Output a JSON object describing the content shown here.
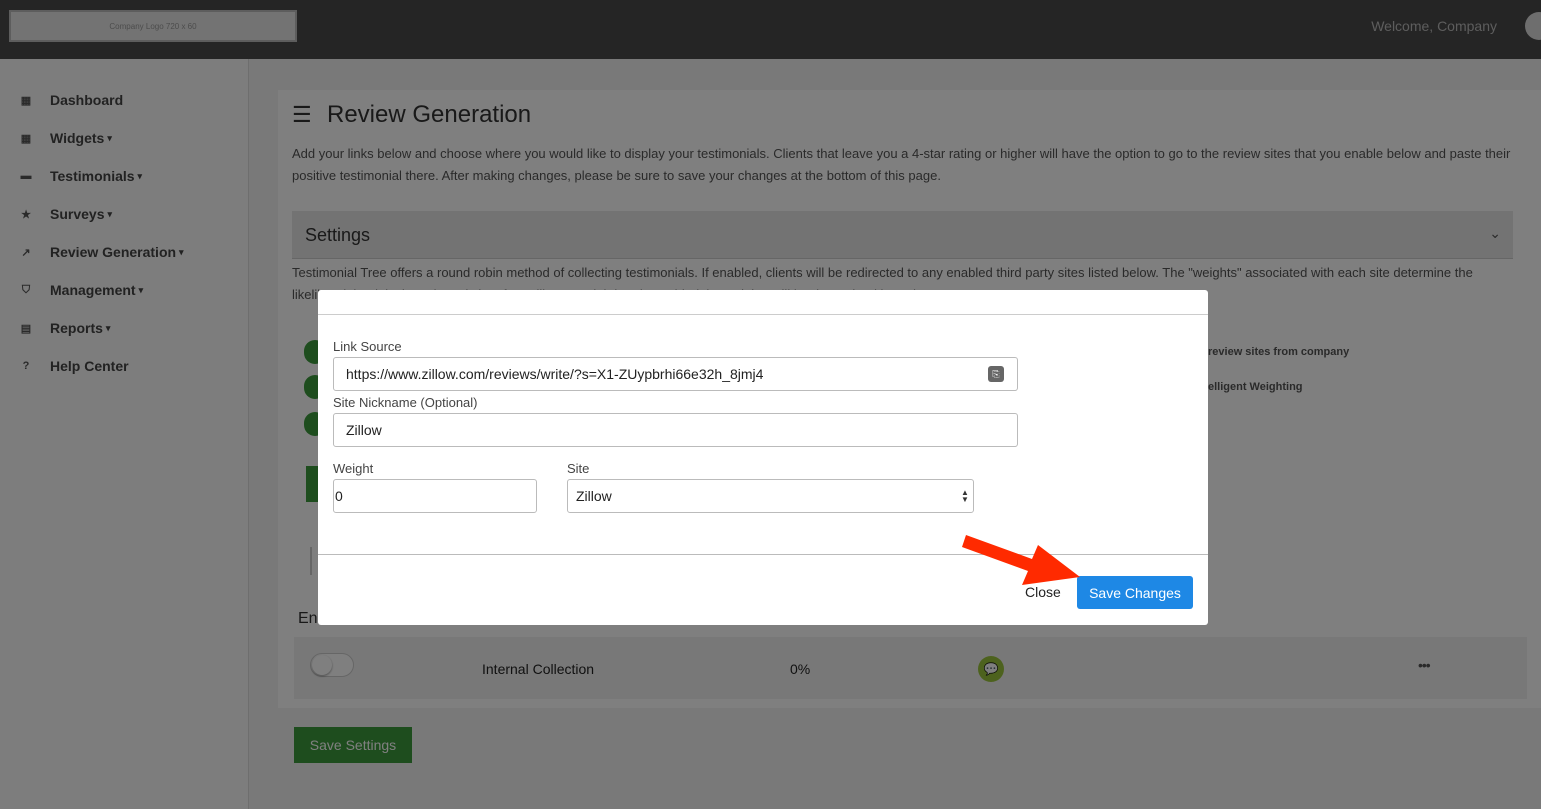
{
  "header": {
    "logo_text": "Company Logo 720 x 60",
    "welcome": "Welcome, Company"
  },
  "sidebar": {
    "items": [
      {
        "label": "Dashboard",
        "icon": "dashboard-icon",
        "has_caret": false
      },
      {
        "label": "Widgets",
        "icon": "widgets-icon",
        "has_caret": true
      },
      {
        "label": "Testimonials",
        "icon": "comment-icon",
        "has_caret": true
      },
      {
        "label": "Surveys",
        "icon": "star-icon",
        "has_caret": true
      },
      {
        "label": "Review Generation",
        "icon": "share-icon",
        "has_caret": true
      },
      {
        "label": "Management",
        "icon": "shield-icon",
        "has_caret": true
      },
      {
        "label": "Reports",
        "icon": "reports-icon",
        "has_caret": true
      },
      {
        "label": "Help Center",
        "icon": "help-icon",
        "has_caret": false
      }
    ]
  },
  "main": {
    "title": "Review Generation",
    "description": "Add your links below and choose where you would like to display your testimonials. Clients that leave you a 4-star rating or higher will have the option to go to the review sites that you enable below and paste their positive testimonial there. After making changes, please be sure to save your changes at the bottom of this page.",
    "settings_title": "Settings",
    "settings_description": "Testimonial Tree offers a round robin method of collecting testimonials. If enabled, clients will be redirected to any enabled third party sites listed below. The \"weights\" associated with each site determine the likelihood that it is the selected site. If \"Intelligent Weighting\" is enabled the weights will be determined based",
    "side_labels": [
      "review sites from company",
      "elligent Weighting"
    ],
    "table_header_partial": "En",
    "table_row": {
      "name": "Internal Collection",
      "weight": "0%",
      "more": "•••"
    },
    "save_settings": "Save Settings"
  },
  "modal": {
    "link_source_label": "Link Source",
    "link_source_value": "https://www.zillow.com/reviews/write/?s=X1-ZUypbrhi66e32h_8jmj4",
    "nickname_label": "Site Nickname (Optional)",
    "nickname_value": "Zillow",
    "weight_label": "Weight",
    "weight_value": "0",
    "site_label": "Site",
    "site_value": "Zillow",
    "close_label": "Close",
    "save_label": "Save Changes"
  },
  "colors": {
    "primary_blue": "#1e88e5",
    "success_green": "#3d9b3d",
    "arrow_red": "#ff2a00"
  }
}
